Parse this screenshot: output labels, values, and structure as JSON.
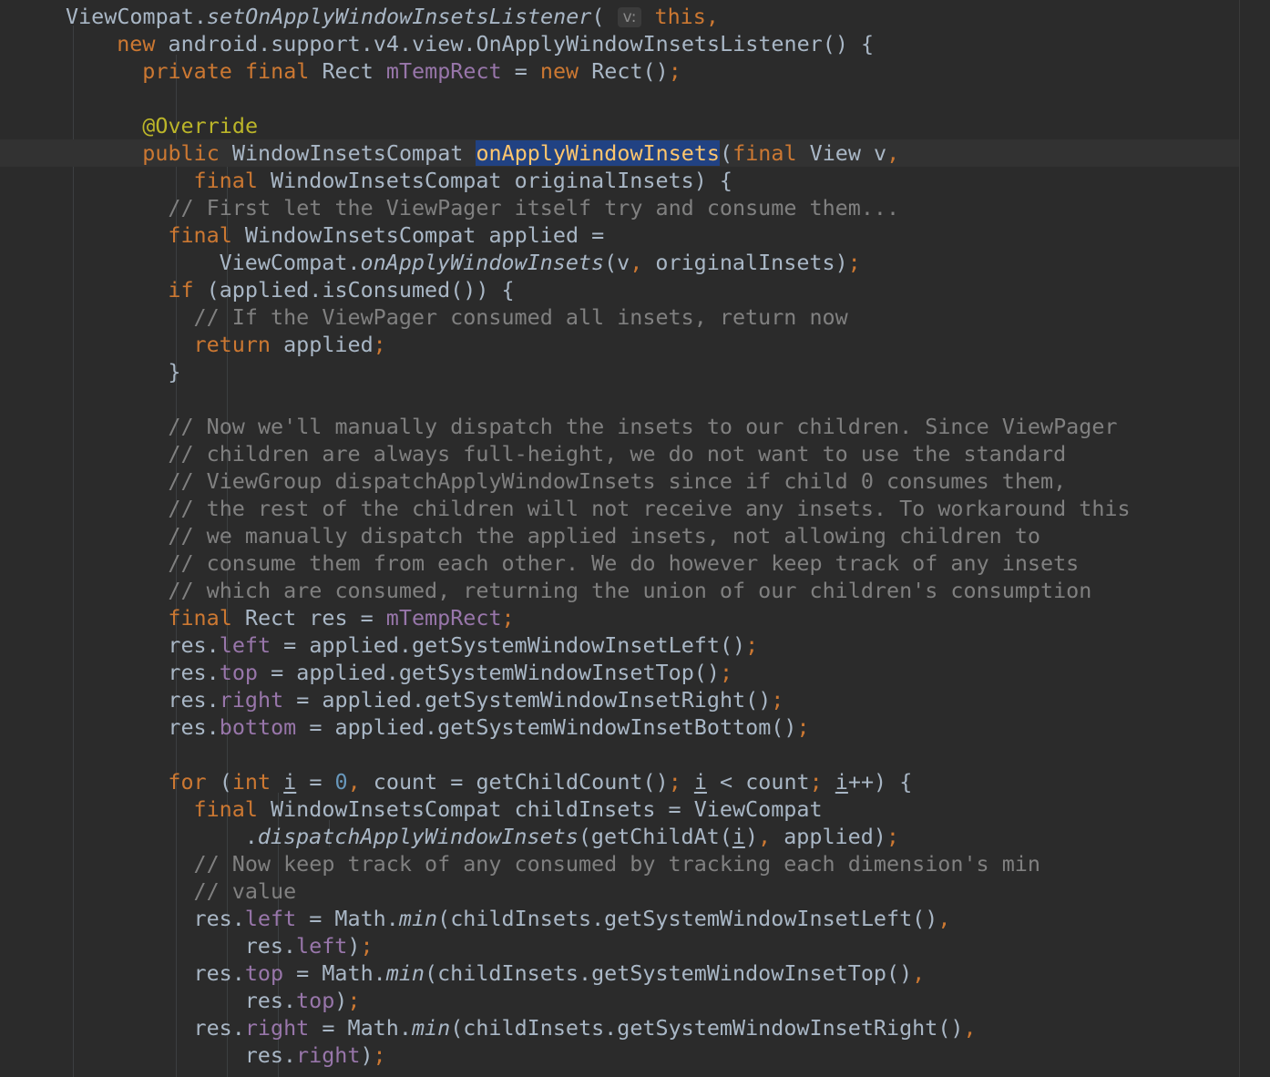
{
  "editor": {
    "caret_line": 5,
    "lines": [
      {
        "indent": 0,
        "tokens": [
          [
            "plain",
            "ViewCompat."
          ],
          [
            "static",
            "setOnApplyWindowInsetsListener"
          ],
          [
            "plain",
            "( "
          ],
          [
            "hint",
            "v:"
          ],
          [
            "plain",
            " "
          ],
          [
            "kw",
            "this,"
          ]
        ]
      },
      {
        "indent": 4,
        "tokens": [
          [
            "kw",
            "new "
          ],
          [
            "plain",
            "android.support.v4.view.OnApplyWindowInsetsListener() {"
          ]
        ]
      },
      {
        "indent": 6,
        "tokens": [
          [
            "kw",
            "private final "
          ],
          [
            "plain",
            "Rect "
          ],
          [
            "field",
            "mTempRect"
          ],
          [
            "plain",
            " = "
          ],
          [
            "kw",
            "new "
          ],
          [
            "plain",
            "Rect()"
          ],
          [
            "kw",
            ";"
          ]
        ]
      },
      {
        "indent": 0,
        "tokens": []
      },
      {
        "indent": 6,
        "tokens": [
          [
            "annotation",
            "@Override"
          ]
        ]
      },
      {
        "indent": 6,
        "tokens": [
          [
            "kw",
            "public "
          ],
          [
            "plain",
            "WindowInsetsCompat "
          ],
          [
            "highlight",
            "onApplyWindowInsets"
          ],
          [
            "plain",
            "("
          ],
          [
            "kw",
            "final "
          ],
          [
            "plain",
            "View v"
          ],
          [
            "kw",
            ","
          ]
        ]
      },
      {
        "indent": 10,
        "tokens": [
          [
            "kw",
            "final "
          ],
          [
            "plain",
            "WindowInsetsCompat originalInsets) {"
          ]
        ]
      },
      {
        "indent": 8,
        "tokens": [
          [
            "comment",
            "// First let the ViewPager itself try and consume them..."
          ]
        ]
      },
      {
        "indent": 8,
        "tokens": [
          [
            "kw",
            "final "
          ],
          [
            "plain",
            "WindowInsetsCompat applied ="
          ]
        ]
      },
      {
        "indent": 12,
        "tokens": [
          [
            "plain",
            "ViewCompat."
          ],
          [
            "static",
            "onApplyWindowInsets"
          ],
          [
            "plain",
            "(v"
          ],
          [
            "kw",
            ", "
          ],
          [
            "plain",
            "originalInsets)"
          ],
          [
            "kw",
            ";"
          ]
        ]
      },
      {
        "indent": 8,
        "tokens": [
          [
            "kw",
            "if "
          ],
          [
            "plain",
            "(applied.isConsumed()) {"
          ]
        ]
      },
      {
        "indent": 10,
        "tokens": [
          [
            "comment",
            "// If the ViewPager consumed all insets, return now"
          ]
        ]
      },
      {
        "indent": 10,
        "tokens": [
          [
            "kw",
            "return "
          ],
          [
            "plain",
            "applied"
          ],
          [
            "kw",
            ";"
          ]
        ]
      },
      {
        "indent": 8,
        "tokens": [
          [
            "plain",
            "}"
          ]
        ]
      },
      {
        "indent": 0,
        "tokens": []
      },
      {
        "indent": 8,
        "tokens": [
          [
            "comment",
            "// Now we'll manually dispatch the insets to our children. Since ViewPager"
          ]
        ]
      },
      {
        "indent": 8,
        "tokens": [
          [
            "comment",
            "// children are always full-height, we do not want to use the standard"
          ]
        ]
      },
      {
        "indent": 8,
        "tokens": [
          [
            "comment",
            "// ViewGroup dispatchApplyWindowInsets since if child 0 consumes them,"
          ]
        ]
      },
      {
        "indent": 8,
        "tokens": [
          [
            "comment",
            "// the rest of the children will not receive any insets. To workaround this"
          ]
        ]
      },
      {
        "indent": 8,
        "tokens": [
          [
            "comment",
            "// we manually dispatch the applied insets, not allowing children to"
          ]
        ]
      },
      {
        "indent": 8,
        "tokens": [
          [
            "comment",
            "// consume them from each other. We do however keep track of any insets"
          ]
        ]
      },
      {
        "indent": 8,
        "tokens": [
          [
            "comment",
            "// which are consumed, returning the union of our children's consumption"
          ]
        ]
      },
      {
        "indent": 8,
        "tokens": [
          [
            "kw",
            "final "
          ],
          [
            "plain",
            "Rect res = "
          ],
          [
            "field",
            "mTempRect"
          ],
          [
            "kw",
            ";"
          ]
        ]
      },
      {
        "indent": 8,
        "tokens": [
          [
            "plain",
            "res."
          ],
          [
            "field",
            "left"
          ],
          [
            "plain",
            " = applied.getSystemWindowInsetLeft()"
          ],
          [
            "kw",
            ";"
          ]
        ]
      },
      {
        "indent": 8,
        "tokens": [
          [
            "plain",
            "res."
          ],
          [
            "field",
            "top"
          ],
          [
            "plain",
            " = applied.getSystemWindowInsetTop()"
          ],
          [
            "kw",
            ";"
          ]
        ]
      },
      {
        "indent": 8,
        "tokens": [
          [
            "plain",
            "res."
          ],
          [
            "field",
            "right"
          ],
          [
            "plain",
            " = applied.getSystemWindowInsetRight()"
          ],
          [
            "kw",
            ";"
          ]
        ]
      },
      {
        "indent": 8,
        "tokens": [
          [
            "plain",
            "res."
          ],
          [
            "field",
            "bottom"
          ],
          [
            "plain",
            " = applied.getSystemWindowInsetBottom()"
          ],
          [
            "kw",
            ";"
          ]
        ]
      },
      {
        "indent": 0,
        "tokens": []
      },
      {
        "indent": 8,
        "tokens": [
          [
            "kw",
            "for "
          ],
          [
            "plain",
            "("
          ],
          [
            "kw",
            "int "
          ],
          [
            "var",
            "i"
          ],
          [
            "plain",
            " = "
          ],
          [
            "number",
            "0"
          ],
          [
            "kw",
            ", "
          ],
          [
            "plain",
            "count = getChildCount()"
          ],
          [
            "kw",
            "; "
          ],
          [
            "var",
            "i"
          ],
          [
            "plain",
            " < count"
          ],
          [
            "kw",
            "; "
          ],
          [
            "var",
            "i"
          ],
          [
            "plain",
            "++) {"
          ]
        ]
      },
      {
        "indent": 10,
        "tokens": [
          [
            "kw",
            "final "
          ],
          [
            "plain",
            "WindowInsetsCompat childInsets = ViewCompat"
          ]
        ]
      },
      {
        "indent": 14,
        "tokens": [
          [
            "plain",
            "."
          ],
          [
            "static",
            "dispatchApplyWindowInsets"
          ],
          [
            "plain",
            "(getChildAt("
          ],
          [
            "var",
            "i"
          ],
          [
            "plain",
            ")"
          ],
          [
            "kw",
            ", "
          ],
          [
            "plain",
            "applied)"
          ],
          [
            "kw",
            ";"
          ]
        ]
      },
      {
        "indent": 10,
        "tokens": [
          [
            "comment",
            "// Now keep track of any consumed by tracking each dimension's min"
          ]
        ]
      },
      {
        "indent": 10,
        "tokens": [
          [
            "comment",
            "// value"
          ]
        ]
      },
      {
        "indent": 10,
        "tokens": [
          [
            "plain",
            "res."
          ],
          [
            "field",
            "left"
          ],
          [
            "plain",
            " = Math."
          ],
          [
            "static",
            "min"
          ],
          [
            "plain",
            "(childInsets.getSystemWindowInsetLeft()"
          ],
          [
            "kw",
            ","
          ]
        ]
      },
      {
        "indent": 14,
        "tokens": [
          [
            "plain",
            "res."
          ],
          [
            "field",
            "left"
          ],
          [
            "plain",
            ")"
          ],
          [
            "kw",
            ";"
          ]
        ]
      },
      {
        "indent": 10,
        "tokens": [
          [
            "plain",
            "res."
          ],
          [
            "field",
            "top"
          ],
          [
            "plain",
            " = Math."
          ],
          [
            "static",
            "min"
          ],
          [
            "plain",
            "(childInsets.getSystemWindowInsetTop()"
          ],
          [
            "kw",
            ","
          ]
        ]
      },
      {
        "indent": 14,
        "tokens": [
          [
            "plain",
            "res."
          ],
          [
            "field",
            "top"
          ],
          [
            "plain",
            ")"
          ],
          [
            "kw",
            ";"
          ]
        ]
      },
      {
        "indent": 10,
        "tokens": [
          [
            "plain",
            "res."
          ],
          [
            "field",
            "right"
          ],
          [
            "plain",
            " = Math."
          ],
          [
            "static",
            "min"
          ],
          [
            "plain",
            "(childInsets.getSystemWindowInsetRight()"
          ],
          [
            "kw",
            ","
          ]
        ]
      },
      {
        "indent": 14,
        "tokens": [
          [
            "plain",
            "res."
          ],
          [
            "field",
            "right"
          ],
          [
            "plain",
            ")"
          ],
          [
            "kw",
            ";"
          ]
        ]
      }
    ]
  }
}
